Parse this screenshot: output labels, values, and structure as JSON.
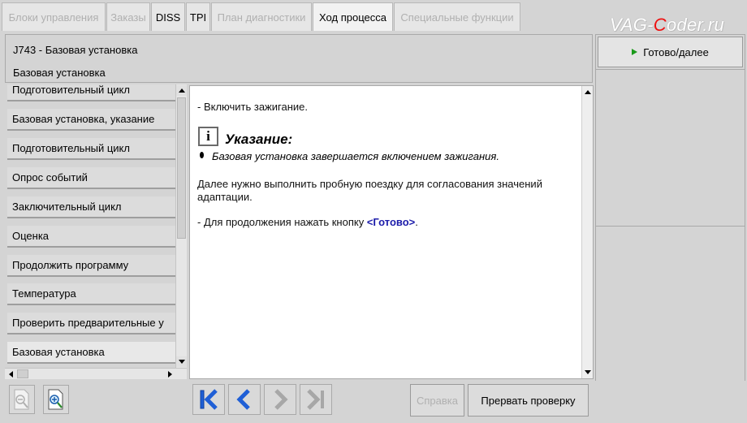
{
  "tabs": [
    {
      "label": "Блоки управления",
      "state": "disabled"
    },
    {
      "label": "Заказы",
      "state": "disabled"
    },
    {
      "label": "DISS",
      "state": "enabled"
    },
    {
      "label": "TPI",
      "state": "enabled"
    },
    {
      "label": "План диагностики",
      "state": "disabled"
    },
    {
      "label": "Ход процесса",
      "state": "active"
    },
    {
      "label": "Специальные функции",
      "state": "disabled"
    }
  ],
  "watermark": {
    "pre": "VAG-",
    "accent": "C",
    "post": "oder.ru"
  },
  "header": {
    "title": "J743 - Базовая установка",
    "subtitle": "Базовая установка"
  },
  "right_panel": {
    "done_button": "Готово/далее"
  },
  "procedure_list": [
    "Подготовительный цикл",
    "Базовая установка, указание",
    "Подготовительный цикл",
    "Опрос событий",
    "Заключительный цикл",
    "Оценка",
    "Продолжить программу",
    "Температура",
    "Проверить предварительные у",
    "Базовая установка"
  ],
  "content": {
    "line1": "- Включить зажигание.",
    "note_icon": "i",
    "note_title": "Указание:",
    "note_body": "Базовая установка завершается включением зажигания.",
    "para1": "Далее нужно выполнить пробную поездку для согласования значений",
    "para2": "адаптации.",
    "continue_prefix": "- Для продолжения нажать кнопку ",
    "continue_link": "<Готово>",
    "continue_suffix": "."
  },
  "bottom": {
    "help_button": "Справка",
    "abort_button": "Прервать проверку"
  },
  "colors": {
    "background": "#d4d4d4",
    "nav_arrow_active": "#1f5fd6",
    "nav_arrow_inactive": "#a7a7a7",
    "link": "#1c1caa",
    "play_icon": "#1a9a1a"
  }
}
